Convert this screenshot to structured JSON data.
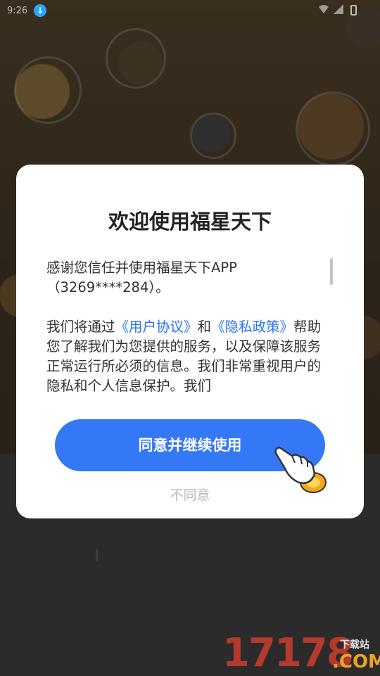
{
  "status_bar": {
    "time": "9:26",
    "notification_icon": "download-icon",
    "wifi_icon": "wifi-icon",
    "signal_icon": "signal-icon",
    "battery_icon": "battery-icon"
  },
  "dialog": {
    "title": "欢迎使用福星天下",
    "paragraph_1": "感谢您信任并使用福星天下APP（3269****284）。",
    "paragraph_2": {
      "before": "我们将通过",
      "link_user_agreement": "《用户协议》",
      "middle": "和",
      "link_privacy_policy": "《隐私政策》",
      "after": "帮助您了解我们为您提供的服务，以及保障该服务正常运行所必须的信息。我们非常重视用户的隐私和个人信息保护。我们"
    },
    "agree_button": "同意并继续使用",
    "disagree_button": "不同意",
    "hand_icon": "pointing-hand-icon"
  },
  "watermark": {
    "digits": "17178",
    "suffix": ".COM",
    "label": "下载站"
  },
  "colors": {
    "accent": "#3478f6",
    "link": "#2a73ff",
    "watermark_red": "#b33a2c",
    "watermark_gold": "#e9a425"
  }
}
